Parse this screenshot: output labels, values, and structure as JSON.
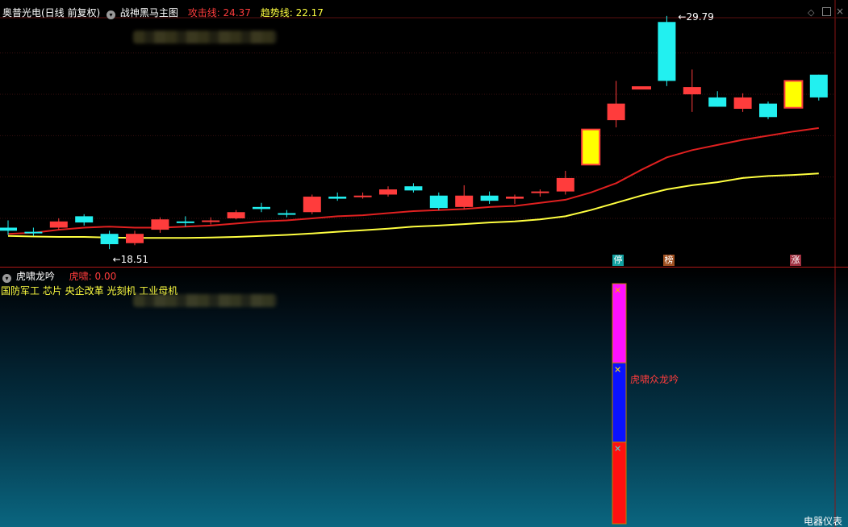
{
  "header": {
    "stock_title": "奥普光电(日线 前复权)",
    "indicator_name": "战神黑马主图",
    "attack_label": "攻击线: 24.37",
    "trend_label": "趋势线: 22.17"
  },
  "sub_header": {
    "indicator_name": "虎啸龙吟",
    "value_label": "虎啸: 0.00"
  },
  "concepts_line": "国防军工 芯片 央企改革 光刻机 工业母机",
  "markers": {
    "high_label": "29.79",
    "low_label": "18.51",
    "tag_stop": "停",
    "tag_list": "榜",
    "tag_up": "涨",
    "signal_label": "虎啸众龙吟"
  },
  "bottom_right_label": "电器仪表",
  "colors": {
    "up": "#ff3c3c",
    "down": "#22f0f0",
    "limit": "#ffff00",
    "attack_line": "#e02020",
    "trend_line": "#ffff40",
    "bar_magenta": "#ff10ff",
    "bar_blue": "#0a12ff",
    "bar_red": "#ff1010"
  },
  "chart_data": {
    "type": "candlestick",
    "candles": [
      {
        "o": 19.55,
        "c": 19.4,
        "h": 19.9,
        "l": 19.2,
        "d": "down"
      },
      {
        "o": 19.35,
        "c": 19.3,
        "h": 19.55,
        "l": 19.15,
        "d": "down"
      },
      {
        "o": 19.55,
        "c": 19.85,
        "h": 20.0,
        "l": 19.45,
        "d": "up"
      },
      {
        "o": 20.1,
        "c": 19.8,
        "h": 20.2,
        "l": 19.65,
        "d": "down"
      },
      {
        "o": 19.25,
        "c": 18.75,
        "h": 19.4,
        "l": 18.51,
        "d": "down"
      },
      {
        "o": 18.8,
        "c": 19.25,
        "h": 19.4,
        "l": 18.7,
        "d": "up"
      },
      {
        "o": 19.45,
        "c": 19.95,
        "h": 20.05,
        "l": 19.3,
        "d": "up"
      },
      {
        "o": 19.85,
        "c": 19.8,
        "h": 20.1,
        "l": 19.6,
        "d": "down"
      },
      {
        "o": 19.85,
        "c": 19.9,
        "h": 20.05,
        "l": 19.7,
        "d": "up"
      },
      {
        "o": 20.0,
        "c": 20.3,
        "h": 20.4,
        "l": 19.95,
        "d": "up"
      },
      {
        "o": 20.55,
        "c": 20.45,
        "h": 20.75,
        "l": 20.3,
        "d": "down"
      },
      {
        "o": 20.25,
        "c": 20.2,
        "h": 20.4,
        "l": 20.05,
        "d": "down"
      },
      {
        "o": 20.3,
        "c": 21.05,
        "h": 21.15,
        "l": 20.2,
        "d": "up"
      },
      {
        "o": 21.05,
        "c": 20.95,
        "h": 21.25,
        "l": 20.85,
        "d": "down"
      },
      {
        "o": 21.05,
        "c": 21.1,
        "h": 21.25,
        "l": 20.95,
        "d": "up"
      },
      {
        "o": 21.15,
        "c": 21.4,
        "h": 21.55,
        "l": 21.05,
        "d": "up"
      },
      {
        "o": 21.55,
        "c": 21.35,
        "h": 21.7,
        "l": 21.25,
        "d": "down"
      },
      {
        "o": 21.1,
        "c": 20.5,
        "h": 21.25,
        "l": 20.4,
        "d": "down"
      },
      {
        "o": 20.55,
        "c": 21.1,
        "h": 21.6,
        "l": 20.45,
        "d": "up"
      },
      {
        "o": 21.1,
        "c": 20.85,
        "h": 21.3,
        "l": 20.7,
        "d": "down"
      },
      {
        "o": 20.95,
        "c": 21.05,
        "h": 21.15,
        "l": 20.7,
        "d": "up"
      },
      {
        "o": 21.25,
        "c": 21.3,
        "h": 21.4,
        "l": 21.05,
        "d": "up"
      },
      {
        "o": 21.3,
        "c": 21.95,
        "h": 22.3,
        "l": 21.15,
        "d": "up"
      },
      {
        "o": 22.6,
        "c": 24.3,
        "h": 24.3,
        "l": 22.6,
        "d": "limit"
      },
      {
        "o": 24.75,
        "c": 25.55,
        "h": 26.65,
        "l": 24.4,
        "d": "up"
      },
      {
        "o": 26.35,
        "c": 26.35,
        "h": 26.35,
        "l": 26.35,
        "d": "limit"
      },
      {
        "o": 29.5,
        "c": 26.65,
        "h": 29.79,
        "l": 26.4,
        "d": "down"
      },
      {
        "o": 26.0,
        "c": 26.35,
        "h": 27.2,
        "l": 25.15,
        "d": "up"
      },
      {
        "o": 25.85,
        "c": 25.4,
        "h": 26.15,
        "l": 25.4,
        "d": "down"
      },
      {
        "o": 25.3,
        "c": 25.85,
        "h": 26.05,
        "l": 25.15,
        "d": "up"
      },
      {
        "o": 25.55,
        "c": 24.9,
        "h": 25.65,
        "l": 24.8,
        "d": "down"
      },
      {
        "o": 25.35,
        "c": 26.65,
        "h": 26.65,
        "l": 25.35,
        "d": "limit"
      },
      {
        "o": 26.95,
        "c": 25.85,
        "h": 26.95,
        "l": 25.7,
        "d": "down"
      }
    ],
    "attack_line": [
      19.25,
      19.3,
      19.45,
      19.55,
      19.6,
      19.55,
      19.55,
      19.6,
      19.65,
      19.75,
      19.85,
      19.9,
      20.0,
      20.1,
      20.15,
      20.25,
      20.35,
      20.4,
      20.45,
      20.55,
      20.6,
      20.75,
      20.9,
      21.25,
      21.7,
      22.35,
      22.95,
      23.3,
      23.55,
      23.8,
      24.0,
      24.2,
      24.37
    ],
    "trend_line": [
      19.15,
      19.12,
      19.1,
      19.1,
      19.07,
      19.05,
      19.05,
      19.05,
      19.07,
      19.1,
      19.15,
      19.2,
      19.27,
      19.35,
      19.42,
      19.5,
      19.6,
      19.65,
      19.72,
      19.8,
      19.85,
      19.95,
      20.1,
      20.4,
      20.75,
      21.1,
      21.4,
      21.6,
      21.75,
      21.95,
      22.05,
      22.1,
      22.17
    ],
    "high_marker": 29.79,
    "low_marker": 18.51,
    "signal_bar": {
      "magenta": [
        0.0,
        0.33
      ],
      "blue": [
        0.33,
        0.66
      ],
      "red": [
        0.66,
        1.0
      ]
    }
  }
}
